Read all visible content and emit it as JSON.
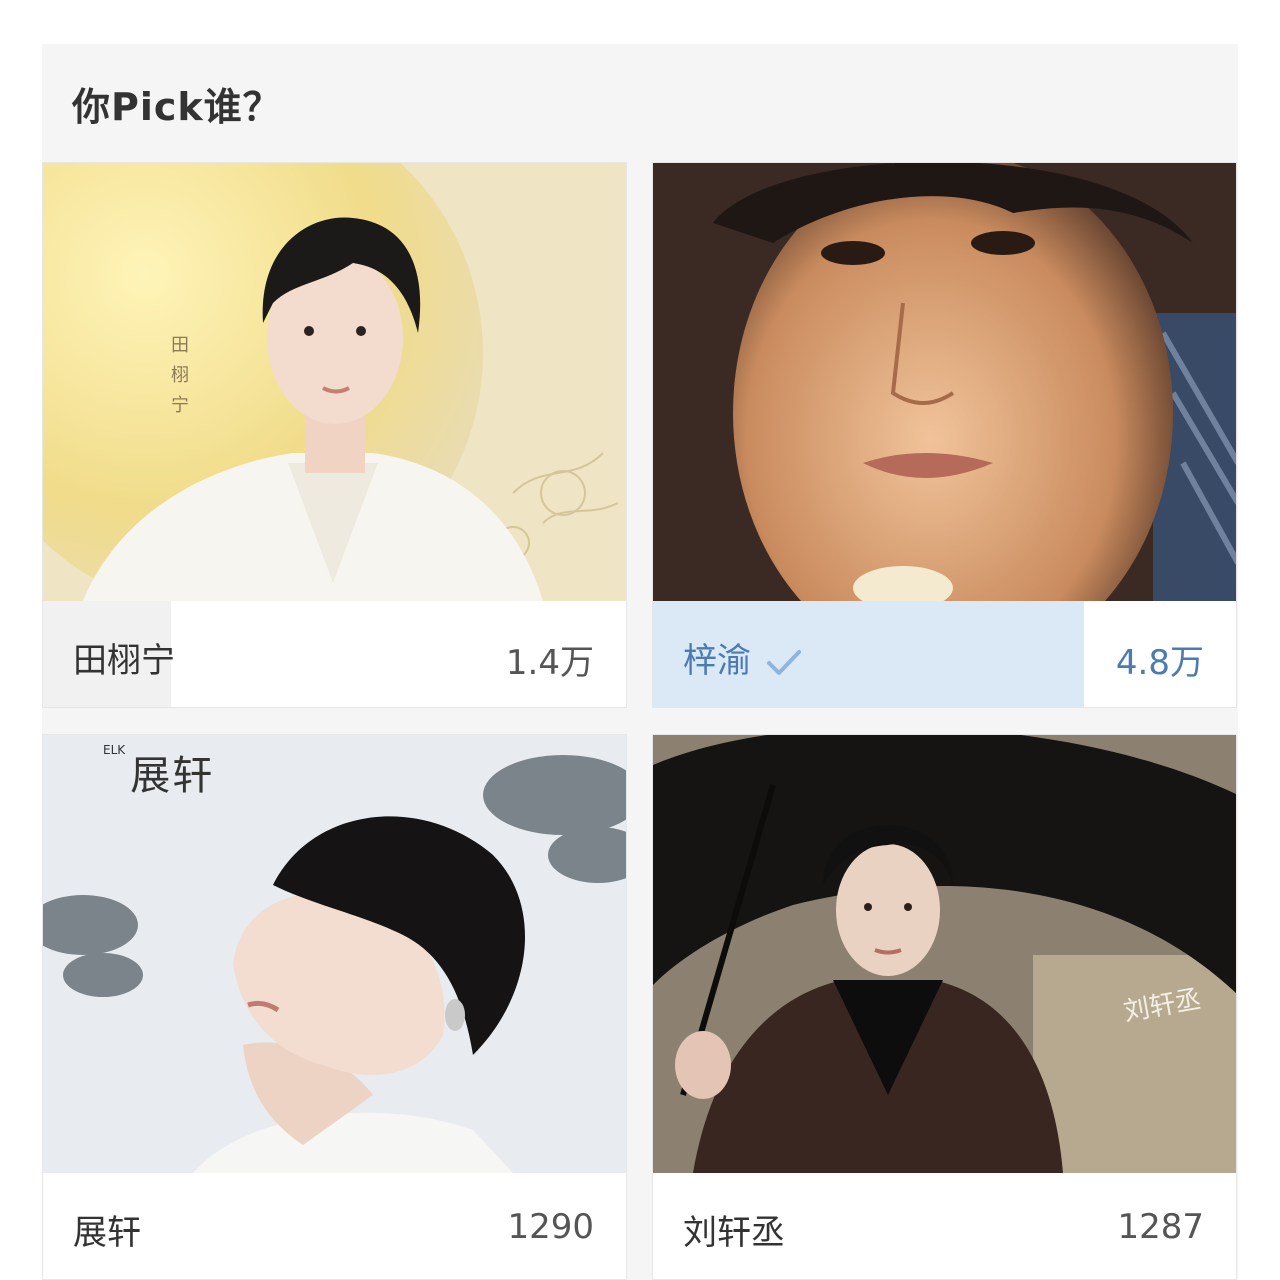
{
  "poll": {
    "title": "你Pick谁？",
    "options": [
      {
        "name": "田栩宁",
        "count": "1.4万",
        "share": 0.22,
        "selected": false
      },
      {
        "name": "梓渝",
        "count": "4.8万",
        "share": 0.74,
        "selected": true
      },
      {
        "name": "展轩",
        "count": "1290",
        "share": 0.0,
        "selected": false
      },
      {
        "name": "刘轩丞",
        "count": "1287",
        "share": 0.0,
        "selected": false
      }
    ]
  },
  "photos": {
    "photo1_vertical_text": "田栩宁",
    "photo3_logo_text": "ELK",
    "photo3_title_text": "展轩",
    "photo4_signature_text": "刘轩丞"
  },
  "colors": {
    "panel_bg": "#f5f5f5",
    "bar_fill_default": "#f1f1f1",
    "bar_fill_selected": "#dbe8f5",
    "selected_text": "#4b7bb0",
    "check_color": "#8fb4dd"
  }
}
